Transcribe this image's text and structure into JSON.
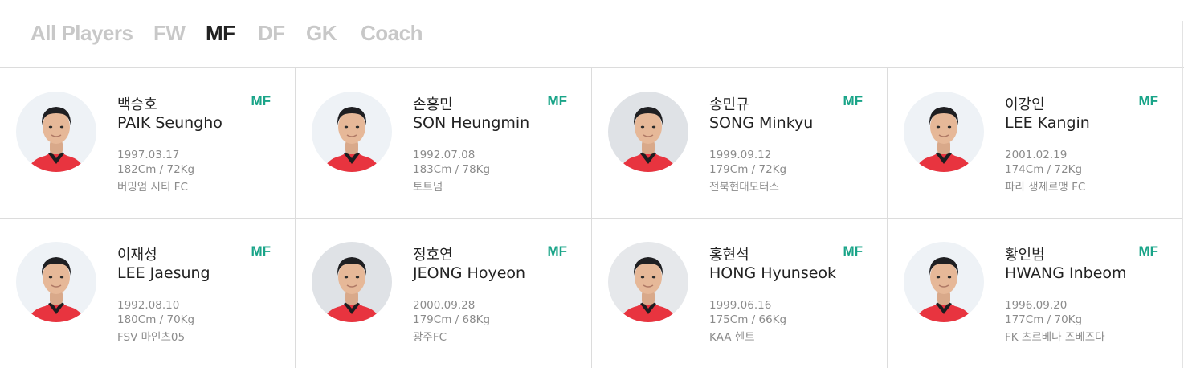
{
  "tabs": [
    {
      "label": "All Players",
      "active": false
    },
    {
      "label": "FW",
      "active": false
    },
    {
      "label": "MF",
      "active": true
    },
    {
      "label": "DF",
      "active": false
    },
    {
      "label": "GK",
      "active": false
    },
    {
      "label": "Coach",
      "active": false
    }
  ],
  "colors": {
    "accent": "#19a488",
    "jersey": "#e8343f",
    "tab_inactive": "#c8c8c8",
    "tab_active": "#222222"
  },
  "players": [
    {
      "name_ko": "백승호",
      "name_en": "PAIK Seungho",
      "position": "MF",
      "birth": "1997.03.17",
      "body": "182Cm / 72Kg",
      "club": "버밍엄 시티 FC"
    },
    {
      "name_ko": "손흥민",
      "name_en": "SON Heungmin",
      "position": "MF",
      "birth": "1992.07.08",
      "body": "183Cm / 78Kg",
      "club": "토트넘"
    },
    {
      "name_ko": "송민규",
      "name_en": "SONG Minkyu",
      "position": "MF",
      "birth": "1999.09.12",
      "body": "179Cm / 72Kg",
      "club": "전북현대모터스"
    },
    {
      "name_ko": "이강인",
      "name_en": "LEE Kangin",
      "position": "MF",
      "birth": "2001.02.19",
      "body": "174Cm / 72Kg",
      "club": "파리 생제르맹 FC"
    },
    {
      "name_ko": "이재성",
      "name_en": "LEE Jaesung",
      "position": "MF",
      "birth": "1992.08.10",
      "body": "180Cm / 70Kg",
      "club": "FSV 마인츠05"
    },
    {
      "name_ko": "정호연",
      "name_en": "JEONG Hoyeon",
      "position": "MF",
      "birth": "2000.09.28",
      "body": "179Cm / 68Kg",
      "club": "광주FC"
    },
    {
      "name_ko": "홍현석",
      "name_en": "HONG Hyunseok",
      "position": "MF",
      "birth": "1999.06.16",
      "body": "175Cm / 66Kg",
      "club": "KAA 헨트"
    },
    {
      "name_ko": "황인범",
      "name_en": "HWANG Inbeom",
      "position": "MF",
      "birth": "1996.09.20",
      "body": "177Cm / 70Kg",
      "club": "FK 츠르베나 즈베즈다"
    }
  ]
}
